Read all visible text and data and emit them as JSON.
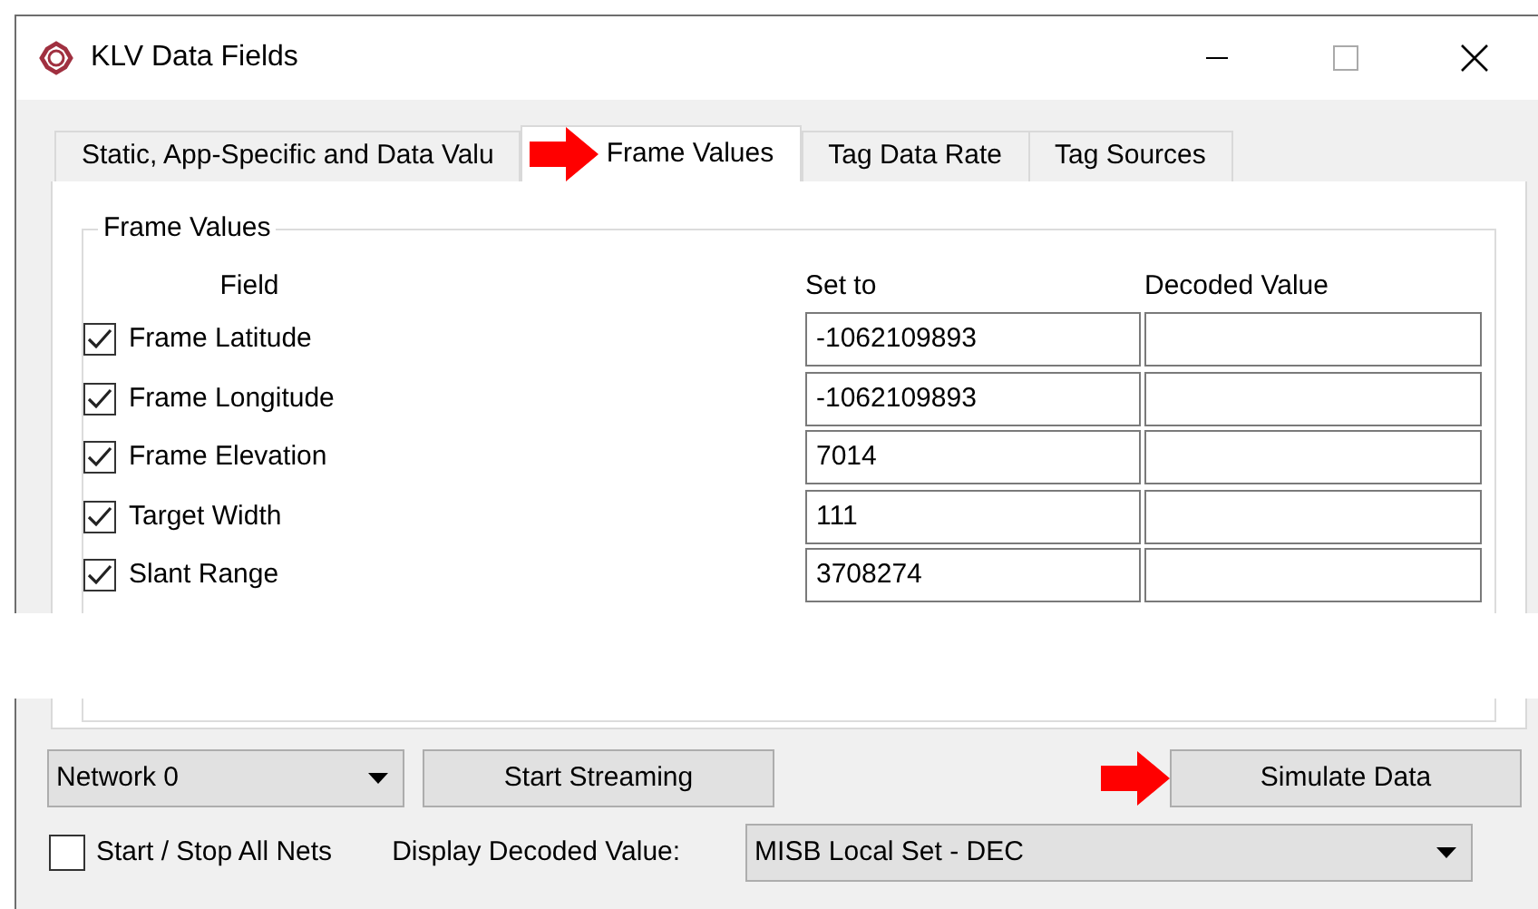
{
  "window": {
    "title": "KLV Data Fields"
  },
  "tabs": [
    {
      "label": "Static, App-Specific and Data Valu",
      "selected": false,
      "pointed": false
    },
    {
      "label": "Frame Values",
      "selected": true,
      "pointed": true
    },
    {
      "label": "Tag Data Rate",
      "selected": false,
      "pointed": false
    },
    {
      "label": "Tag Sources",
      "selected": false,
      "pointed": false
    }
  ],
  "group": {
    "title": "Frame Values",
    "columns": [
      "Field",
      "Set to",
      "Decoded Value"
    ],
    "rows": [
      {
        "field": "Frame Latitude",
        "checked": true,
        "set_to": "-1062109893"
      },
      {
        "field": "Frame Longitude",
        "checked": true,
        "set_to": "-1062109893"
      },
      {
        "field": "Frame Elevation",
        "checked": true,
        "set_to": "7014"
      },
      {
        "field": "Target Width",
        "checked": true,
        "set_to": "111"
      },
      {
        "field": "Slant Range",
        "checked": true,
        "set_to": "3708274"
      }
    ]
  },
  "network": {
    "value": "Network 0"
  },
  "stream_button": {
    "label": "Start Streaming",
    "pointed": false
  },
  "simulate_button": {
    "label": "Simulate Data",
    "pointed": true
  },
  "all_nets": {
    "label": "Start / Stop All Nets",
    "checked": false
  },
  "display": {
    "label": "Display Decoded Value:",
    "value": "MISB Local Set - DEC"
  }
}
